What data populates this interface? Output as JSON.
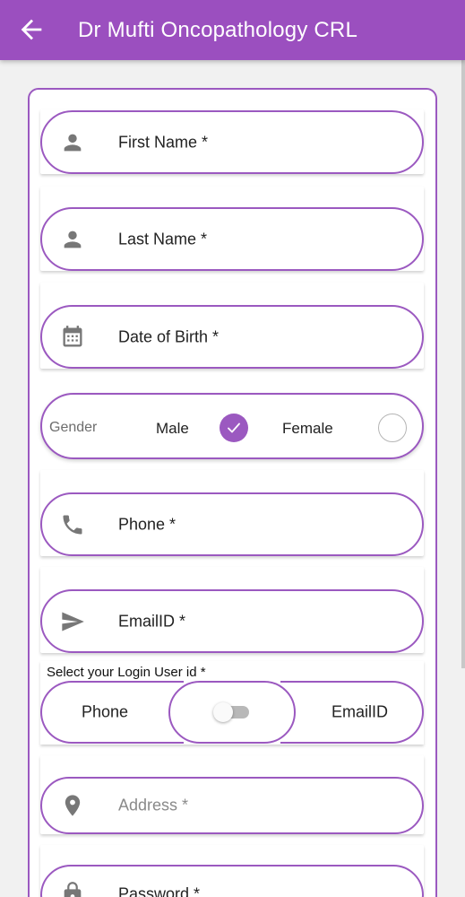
{
  "appbar": {
    "title": "Dr Mufti Oncopathology CRL",
    "back_icon": "arrow-left-icon",
    "color": "#9b4fbf"
  },
  "form": {
    "accent": "#9b59c0",
    "first_name": {
      "label": "First Name *",
      "icon": "person-icon"
    },
    "last_name": {
      "label": "Last Name *",
      "icon": "person-icon"
    },
    "dob": {
      "label": "Date of Birth *",
      "icon": "calendar-icon"
    },
    "gender": {
      "label": "Gender",
      "male": "Male",
      "female": "Female",
      "selected": "Male"
    },
    "phone": {
      "label": "Phone *",
      "icon": "phone-icon"
    },
    "email": {
      "label": "EmailID *",
      "icon": "send-icon"
    },
    "login": {
      "caption": "Select your Login User id *",
      "option_left": "Phone",
      "option_right": "EmailID",
      "toggle_on": false
    },
    "address": {
      "placeholder": "Address *",
      "icon": "location-pin-icon"
    },
    "password": {
      "label": "Password *",
      "icon": "lock-icon"
    }
  }
}
